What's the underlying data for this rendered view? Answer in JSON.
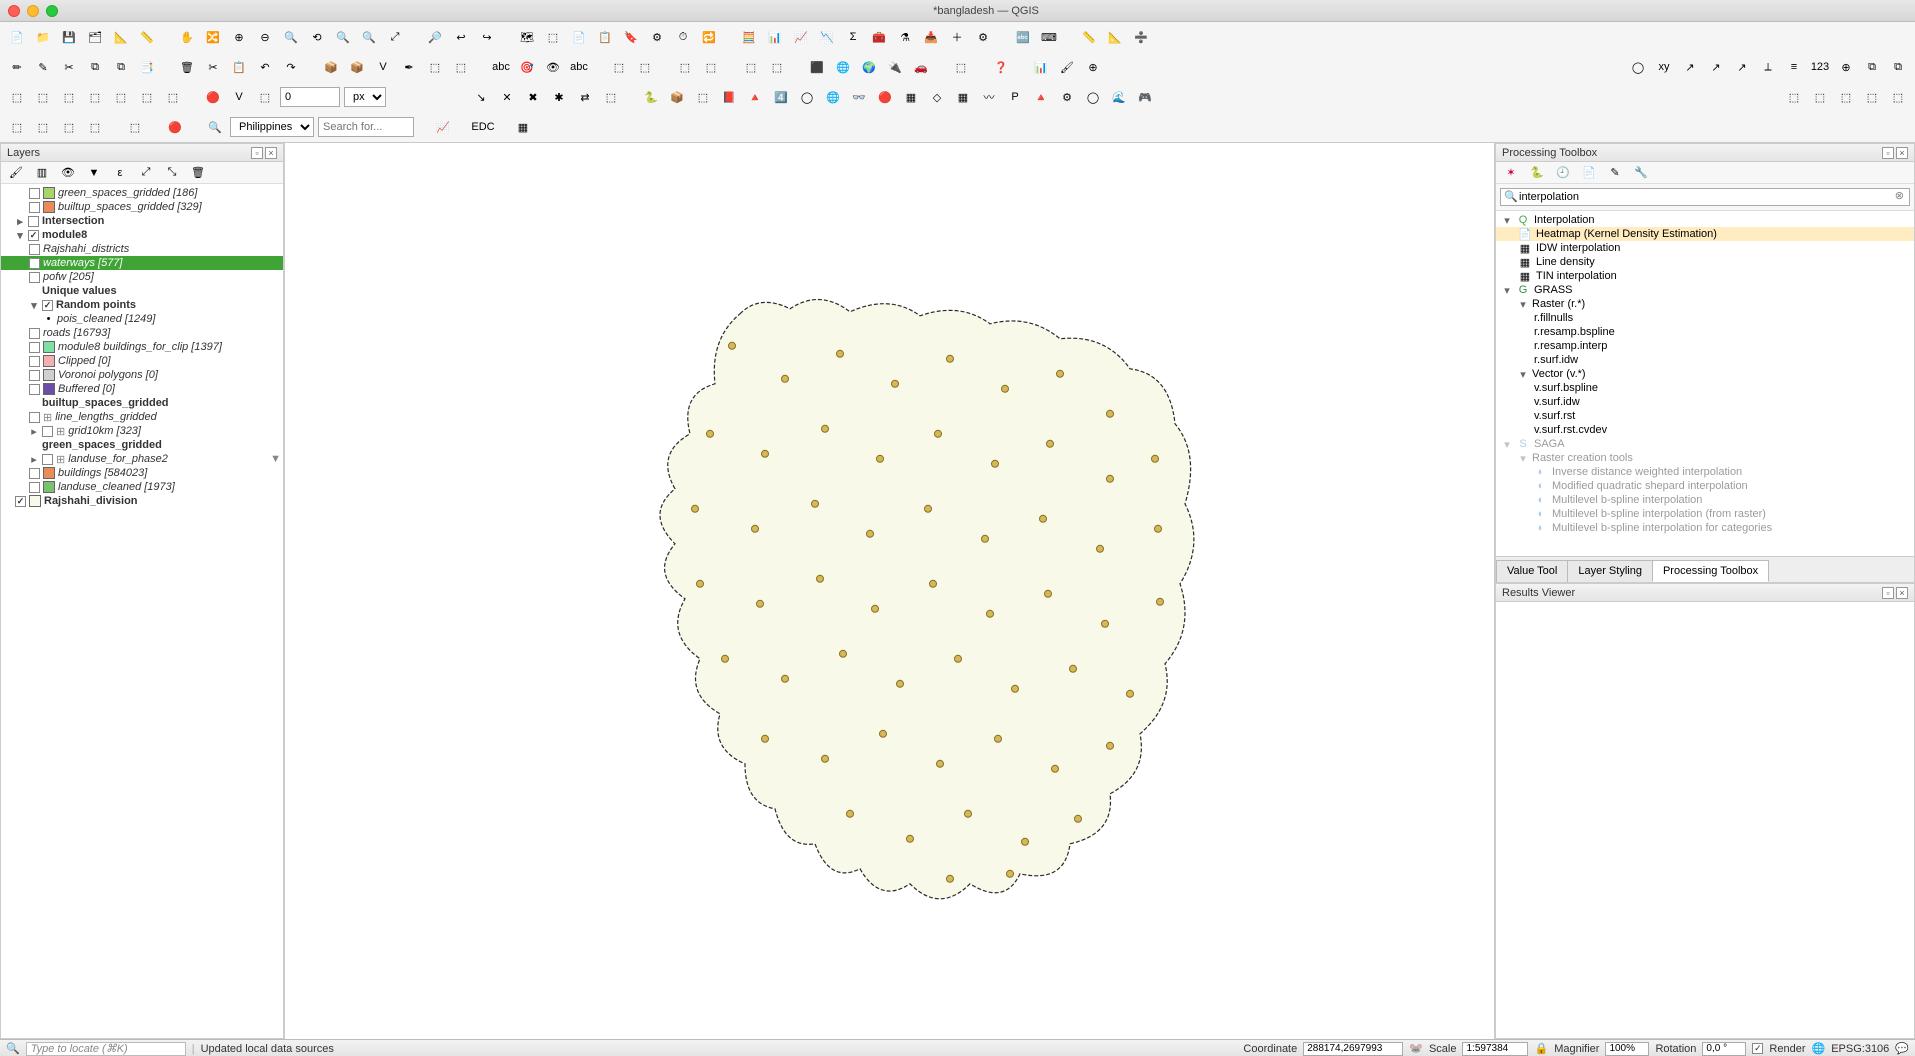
{
  "window": {
    "title": "*bangladesh — QGIS"
  },
  "toolbar": {
    "rotation_value": "0",
    "rotation_unit": "px",
    "region": "Philippines",
    "search_placeholder": "Search for..."
  },
  "layers_panel": {
    "title": "Layers",
    "items": [
      {
        "type": "layer",
        "indent": 2,
        "checked": false,
        "swatch": "#a9d46a",
        "label": "green_spaces_gridded [186]"
      },
      {
        "type": "layer",
        "indent": 2,
        "checked": false,
        "swatch": "#e98c5a",
        "label": "builtup_spaces_gridded [329]"
      },
      {
        "type": "group",
        "indent": 1,
        "checked": false,
        "tri": "▸",
        "label": "Intersection"
      },
      {
        "type": "group",
        "indent": 1,
        "checked": true,
        "tri": "▾",
        "label": "module8"
      },
      {
        "type": "layer",
        "indent": 2,
        "checked": false,
        "label": "Rajshahi_districts"
      },
      {
        "type": "layer",
        "indent": 2,
        "checked": false,
        "label": "waterways [577]",
        "selected": true
      },
      {
        "type": "layer",
        "indent": 2,
        "checked": false,
        "label": "pofw [205]"
      },
      {
        "type": "group",
        "indent": 2,
        "tri": "",
        "label": "Unique values"
      },
      {
        "type": "group",
        "indent": 2,
        "checked": true,
        "tri": "▾",
        "label": "Random points"
      },
      {
        "type": "layer",
        "indent": 3,
        "bullet": true,
        "label": "pois_cleaned [1249]"
      },
      {
        "type": "layer",
        "indent": 2,
        "checked": false,
        "label": "roads [16793]"
      },
      {
        "type": "layer",
        "indent": 2,
        "checked": false,
        "swatch": "#7ee0a5",
        "label": "module8 buildings_for_clip [1397]"
      },
      {
        "type": "layer",
        "indent": 2,
        "checked": false,
        "swatch": "#f3b0b0",
        "label": "Clipped [0]"
      },
      {
        "type": "layer",
        "indent": 2,
        "checked": false,
        "swatch": "#d0d0d0",
        "label": "Voronoi polygons [0]"
      },
      {
        "type": "layer",
        "indent": 2,
        "checked": false,
        "swatch": "#6a4ea8",
        "label": "Buffered [0]"
      },
      {
        "type": "group",
        "indent": 2,
        "tri": "",
        "label": "builtup_spaces_gridded"
      },
      {
        "type": "layer",
        "indent": 2,
        "checked": false,
        "iconlabel": "⊞",
        "label": "line_lengths_gridded"
      },
      {
        "type": "layer",
        "indent": 2,
        "checked": false,
        "iconlabel": "⊞",
        "tri": "▸",
        "label": "grid10km [323]"
      },
      {
        "type": "group",
        "indent": 2,
        "tri": "",
        "label": "green_spaces_gridded"
      },
      {
        "type": "layer",
        "indent": 2,
        "checked": false,
        "iconlabel": "⊞",
        "tri": "▸",
        "label": "landuse_for_phase2",
        "filter": true
      },
      {
        "type": "layer",
        "indent": 2,
        "checked": false,
        "swatch": "#e98c5a",
        "label": "buildings [584023]"
      },
      {
        "type": "layer",
        "indent": 2,
        "checked": false,
        "swatch": "#77c36e",
        "label": "landuse_cleaned [1973]"
      },
      {
        "type": "layer",
        "indent": 1,
        "checked": true,
        "swatch": "#f8f9e8",
        "label": "Rajshahi_division",
        "bold": true
      }
    ]
  },
  "processing": {
    "title": "Processing Toolbox",
    "search_value": "interpolation",
    "tree": [
      {
        "indent": 0,
        "tri": "▾",
        "icon": "Q",
        "iconcolor": "#4aa84a",
        "label": "Interpolation"
      },
      {
        "indent": 1,
        "icon": "📄",
        "label": "Heatmap (Kernel Density Estimation)",
        "selected": true
      },
      {
        "indent": 1,
        "icon": "▦",
        "label": "IDW interpolation"
      },
      {
        "indent": 1,
        "icon": "▦",
        "label": "Line density"
      },
      {
        "indent": 1,
        "icon": "▦",
        "label": "TIN interpolation"
      },
      {
        "indent": 0,
        "tri": "▾",
        "icon": "G",
        "iconcolor": "#2e9145",
        "label": "GRASS"
      },
      {
        "indent": 1,
        "tri": "▾",
        "label": "Raster (r.*)"
      },
      {
        "indent": 2,
        "label": "r.fillnulls"
      },
      {
        "indent": 2,
        "label": "r.resamp.bspline"
      },
      {
        "indent": 2,
        "label": "r.resamp.interp"
      },
      {
        "indent": 2,
        "label": "r.surf.idw"
      },
      {
        "indent": 1,
        "tri": "▾",
        "label": "Vector (v.*)"
      },
      {
        "indent": 2,
        "label": "v.surf.bspline"
      },
      {
        "indent": 2,
        "label": "v.surf.idw"
      },
      {
        "indent": 2,
        "label": "v.surf.rst"
      },
      {
        "indent": 2,
        "label": "v.surf.rst.cvdev"
      },
      {
        "indent": 0,
        "tri": "▾",
        "icon": "S",
        "iconcolor": "#3a7ec2",
        "label": "SAGA",
        "faded": true
      },
      {
        "indent": 1,
        "tri": "▾",
        "label": "Raster creation tools",
        "faded": true
      },
      {
        "indent": 2,
        "icon": "◐",
        "iconcolor": "#3a7ec2",
        "label": "Inverse distance weighted interpolation",
        "faded": true
      },
      {
        "indent": 2,
        "icon": "◐",
        "iconcolor": "#3a7ec2",
        "label": "Modified quadratic shepard interpolation",
        "faded": true
      },
      {
        "indent": 2,
        "icon": "◐",
        "iconcolor": "#3a7ec2",
        "label": "Multilevel b-spline interpolation",
        "faded": true
      },
      {
        "indent": 2,
        "icon": "◐",
        "iconcolor": "#3a7ec2",
        "label": "Multilevel b-spline interpolation (from raster)",
        "faded": true
      },
      {
        "indent": 2,
        "icon": "◐",
        "iconcolor": "#3a7ec2",
        "label": "Multilevel b-spline interpolation for categories",
        "faded": true
      }
    ],
    "tabs": [
      {
        "label": "Value Tool",
        "active": false
      },
      {
        "label": "Layer Styling",
        "active": false
      },
      {
        "label": "Processing Toolbox",
        "active": true
      }
    ]
  },
  "results": {
    "title": "Results Viewer"
  },
  "statusbar": {
    "locator_placeholder": "Type to locate (⌘K)",
    "message": "Updated local data sources",
    "coord_label": "Coordinate",
    "coord_value": "288174,2697993",
    "scale_label": "Scale",
    "scale_value": "1:597384",
    "magnifier_label": "Magnifier",
    "magnifier_value": "100%",
    "rotation_label": "Rotation",
    "rotation_value": "0,0 °",
    "render_label": "Render",
    "crs": "EPSG:3106"
  },
  "toolbar_icons": {
    "row1": [
      "📄",
      "📁",
      "💾",
      "🗂",
      "📐",
      "📏",
      "|",
      "✋",
      "🔀",
      "⊕",
      "⊖",
      "🔍",
      "⟲",
      "🔍",
      "🔍",
      "⤢",
      "|",
      "🔎",
      "↩",
      "↪",
      "|",
      "🗺",
      "⬚",
      "📄",
      "📋",
      "🔖",
      "⚙",
      "⏱",
      "🔁",
      "|",
      "🧮",
      "📊",
      "📈",
      "📉",
      "Σ",
      "🧰",
      "⚗",
      "📥",
      "＋",
      "⚙",
      "|",
      "🔤",
      "⌨",
      "|",
      "📏",
      "📐",
      "➗",
      "",
      "",
      "|",
      "",
      "",
      "",
      "",
      "",
      "",
      "",
      "",
      "",
      "",
      "",
      "",
      "",
      "",
      "",
      "",
      ""
    ],
    "row2": [
      "✏",
      "✎",
      "✂",
      "⧉",
      "⧉",
      "📑",
      "|",
      "🗑",
      "✂",
      "📋",
      "↶",
      "↷",
      "|",
      "📦",
      "📦",
      "V",
      "✒",
      "⬚",
      "⬚",
      "|",
      "abc",
      "🎯",
      "👁",
      "abc",
      "|",
      "⬚",
      "⬚",
      "|",
      "⬚",
      "⬚",
      "|",
      "⬚",
      "⬚",
      "|",
      "⬛",
      "🌐",
      "🌍",
      "🔌",
      "🚗",
      "|",
      "⬚",
      "|",
      "❓",
      "|",
      "📊",
      "🖌",
      "⊕"
    ],
    "row3": [
      "⬚",
      "⬚",
      "⬚",
      "⬚",
      "⬚",
      "⬚",
      "⬚",
      "|",
      "🔴",
      "V",
      "⬚",
      "|",
      "",
      "",
      "|",
      "↘",
      "✕",
      "✖",
      "✱",
      "⇄",
      "⬚",
      "|",
      "🐍",
      "📦",
      "⬚",
      "📕",
      "🔺",
      "4️⃣",
      "◯",
      "🌐",
      "👓",
      "🔴",
      "▦",
      "◇",
      "▦",
      "〰",
      "P",
      "🔺",
      "⚙",
      "◯",
      "🌊",
      "🎮"
    ],
    "row4": [
      "⬚",
      "⬚",
      "⬚",
      "⬚",
      "|",
      "⬚",
      "|",
      "🔴",
      "|",
      "🔍"
    ]
  }
}
